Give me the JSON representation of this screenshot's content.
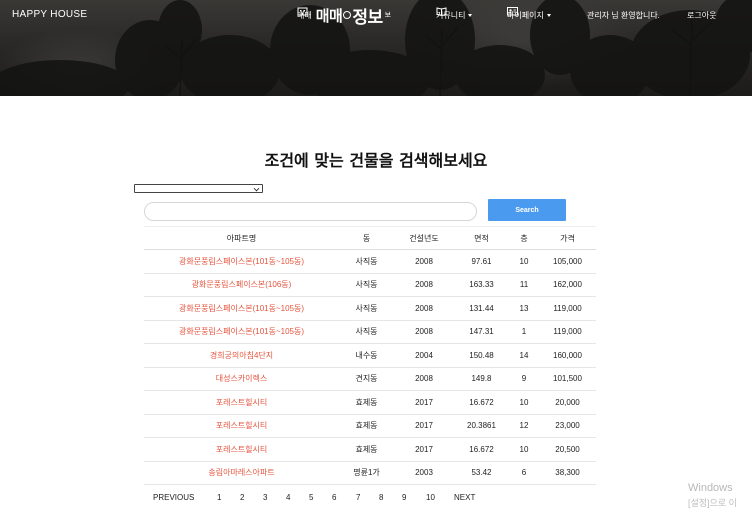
{
  "brand": "HAPPY HOUSE",
  "nav": {
    "trade_prefix": "매매",
    "trade_logo_1": "매매",
    "trade_logo_2": "정보",
    "trade_suffix": "보",
    "community": "커뮤니티",
    "mypage": "마이페이지",
    "welcome": "관리자 님 환영합니다.",
    "logout": "로그아웃"
  },
  "main": {
    "title": "조건에 맞는 건물을 검색해보세요",
    "select_value": "",
    "search_placeholder": "",
    "search_button": "Search"
  },
  "table": {
    "headers": [
      "아파트명",
      "동",
      "건설년도",
      "면적",
      "층",
      "가격"
    ],
    "rows": [
      [
        "광화문풍림스페이스본(101동~105동)",
        "사직동",
        "2008",
        "97.61",
        "10",
        "105,000"
      ],
      [
        "광화문풍림스페이스본(106동)",
        "사직동",
        "2008",
        "163.33",
        "11",
        "162,000"
      ],
      [
        "광화문풍림스페이스본(101동~105동)",
        "사직동",
        "2008",
        "131.44",
        "13",
        "119,000"
      ],
      [
        "광화문풍림스페이스본(101동~105동)",
        "사직동",
        "2008",
        "147.31",
        "1",
        "119,000"
      ],
      [
        "경희궁의아침4단지",
        "내수동",
        "2004",
        "150.48",
        "14",
        "160,000"
      ],
      [
        "대성스카이렉스",
        "견지동",
        "2008",
        "149.8",
        "9",
        "101,500"
      ],
      [
        "포레스트힐시티",
        "효제동",
        "2017",
        "16.672",
        "10",
        "20,000"
      ],
      [
        "포레스트힐시티",
        "효제동",
        "2017",
        "20.3861",
        "12",
        "23,000"
      ],
      [
        "포레스트힐시티",
        "효제동",
        "2017",
        "16.672",
        "10",
        "20,500"
      ],
      [
        "송림아마레스아파트",
        "명륜1가",
        "2003",
        "53.42",
        "6",
        "38,300"
      ]
    ]
  },
  "pagination": {
    "previous": "PREVIOUS",
    "pages": [
      "1",
      "2",
      "3",
      "4",
      "5",
      "6",
      "7",
      "8",
      "9",
      "10"
    ],
    "next": "NEXT"
  },
  "watermark": {
    "line1": "Windows",
    "line2": "[설정]으로 이"
  },
  "colors": {
    "accent": "#4a9bf0",
    "apt_link": "#e5533c",
    "header_bg": "#2a2927"
  }
}
